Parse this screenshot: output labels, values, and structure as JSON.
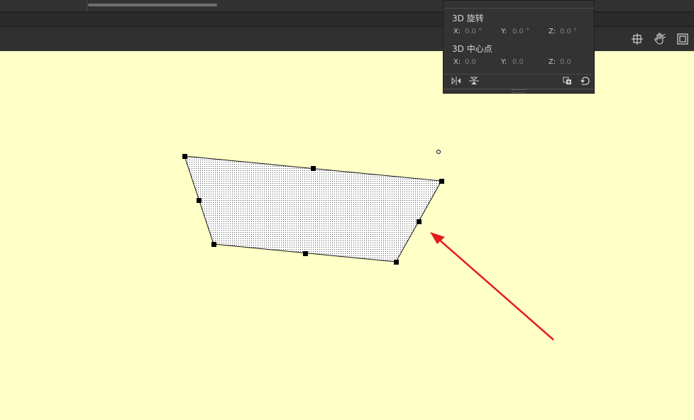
{
  "panel": {
    "rotation": {
      "title": "3D 旋转",
      "x_label": "X:",
      "x_value": "0.0 °",
      "y_label": "Y:",
      "y_value": "0.0 °",
      "z_label": "Z:",
      "z_value": "0.0 °"
    },
    "center": {
      "title": "3D 中心点",
      "x_label": "X:",
      "x_value": "0.0",
      "y_label": "Y:",
      "y_value": "0.0",
      "z_label": "Z:",
      "z_value": "0.0"
    }
  },
  "icons": {
    "toolbar": [
      "center-stage-icon",
      "hand-tool-icon",
      "clip-stage-icon"
    ],
    "panel_footer": [
      "flip-horizontal-icon",
      "flip-vertical-icon",
      "duplicate-icon",
      "reset-icon"
    ]
  },
  "colors": {
    "stage_background": "#ffffc8",
    "arrow": "#e51c1c",
    "panel_background": "#333333"
  }
}
